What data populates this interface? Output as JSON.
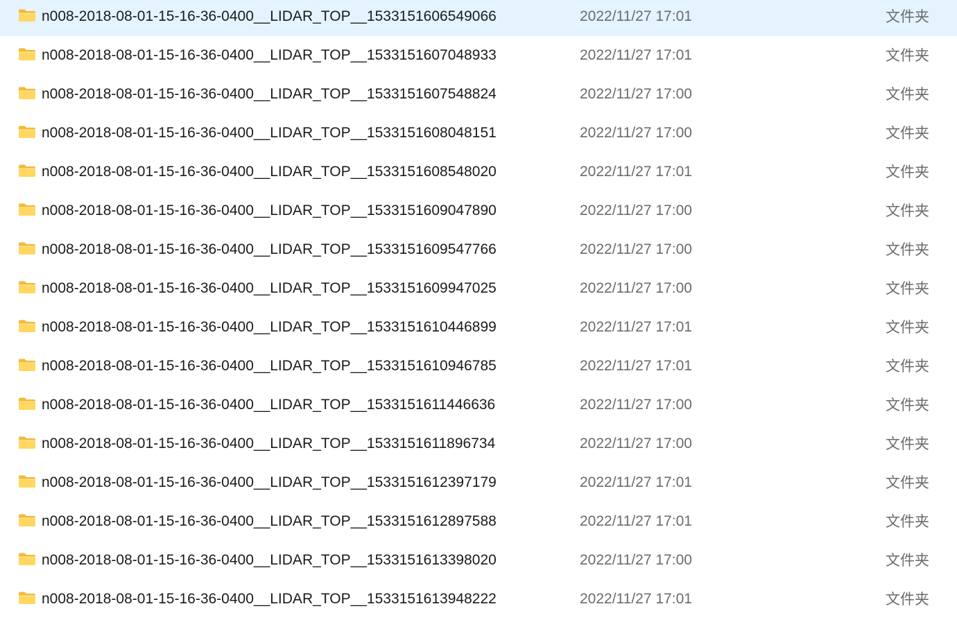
{
  "colors": {
    "name_text": "#1b1b1b",
    "secondary_text": "#6b6b6b",
    "folder_front": "#ffd761",
    "folder_back": "#f4b93a",
    "background": "#ffffff"
  },
  "icons": {
    "row_icon": "folder-icon"
  },
  "files": [
    {
      "name": "n008-2018-08-01-15-16-36-0400__LIDAR_TOP__1533151606549066",
      "modified": "2022/11/27 17:01",
      "type": "文件夹"
    },
    {
      "name": "n008-2018-08-01-15-16-36-0400__LIDAR_TOP__1533151607048933",
      "modified": "2022/11/27 17:01",
      "type": "文件夹"
    },
    {
      "name": "n008-2018-08-01-15-16-36-0400__LIDAR_TOP__1533151607548824",
      "modified": "2022/11/27 17:00",
      "type": "文件夹"
    },
    {
      "name": "n008-2018-08-01-15-16-36-0400__LIDAR_TOP__1533151608048151",
      "modified": "2022/11/27 17:00",
      "type": "文件夹"
    },
    {
      "name": "n008-2018-08-01-15-16-36-0400__LIDAR_TOP__1533151608548020",
      "modified": "2022/11/27 17:01",
      "type": "文件夹"
    },
    {
      "name": "n008-2018-08-01-15-16-36-0400__LIDAR_TOP__1533151609047890",
      "modified": "2022/11/27 17:00",
      "type": "文件夹"
    },
    {
      "name": "n008-2018-08-01-15-16-36-0400__LIDAR_TOP__1533151609547766",
      "modified": "2022/11/27 17:00",
      "type": "文件夹"
    },
    {
      "name": "n008-2018-08-01-15-16-36-0400__LIDAR_TOP__1533151609947025",
      "modified": "2022/11/27 17:00",
      "type": "文件夹"
    },
    {
      "name": "n008-2018-08-01-15-16-36-0400__LIDAR_TOP__1533151610446899",
      "modified": "2022/11/27 17:01",
      "type": "文件夹"
    },
    {
      "name": "n008-2018-08-01-15-16-36-0400__LIDAR_TOP__1533151610946785",
      "modified": "2022/11/27 17:01",
      "type": "文件夹"
    },
    {
      "name": "n008-2018-08-01-15-16-36-0400__LIDAR_TOP__1533151611446636",
      "modified": "2022/11/27 17:00",
      "type": "文件夹"
    },
    {
      "name": "n008-2018-08-01-15-16-36-0400__LIDAR_TOP__1533151611896734",
      "modified": "2022/11/27 17:00",
      "type": "文件夹"
    },
    {
      "name": "n008-2018-08-01-15-16-36-0400__LIDAR_TOP__1533151612397179",
      "modified": "2022/11/27 17:01",
      "type": "文件夹"
    },
    {
      "name": "n008-2018-08-01-15-16-36-0400__LIDAR_TOP__1533151612897588",
      "modified": "2022/11/27 17:01",
      "type": "文件夹"
    },
    {
      "name": "n008-2018-08-01-15-16-36-0400__LIDAR_TOP__1533151613398020",
      "modified": "2022/11/27 17:00",
      "type": "文件夹"
    },
    {
      "name": "n008-2018-08-01-15-16-36-0400__LIDAR_TOP__1533151613948222",
      "modified": "2022/11/27 17:01",
      "type": "文件夹"
    }
  ]
}
